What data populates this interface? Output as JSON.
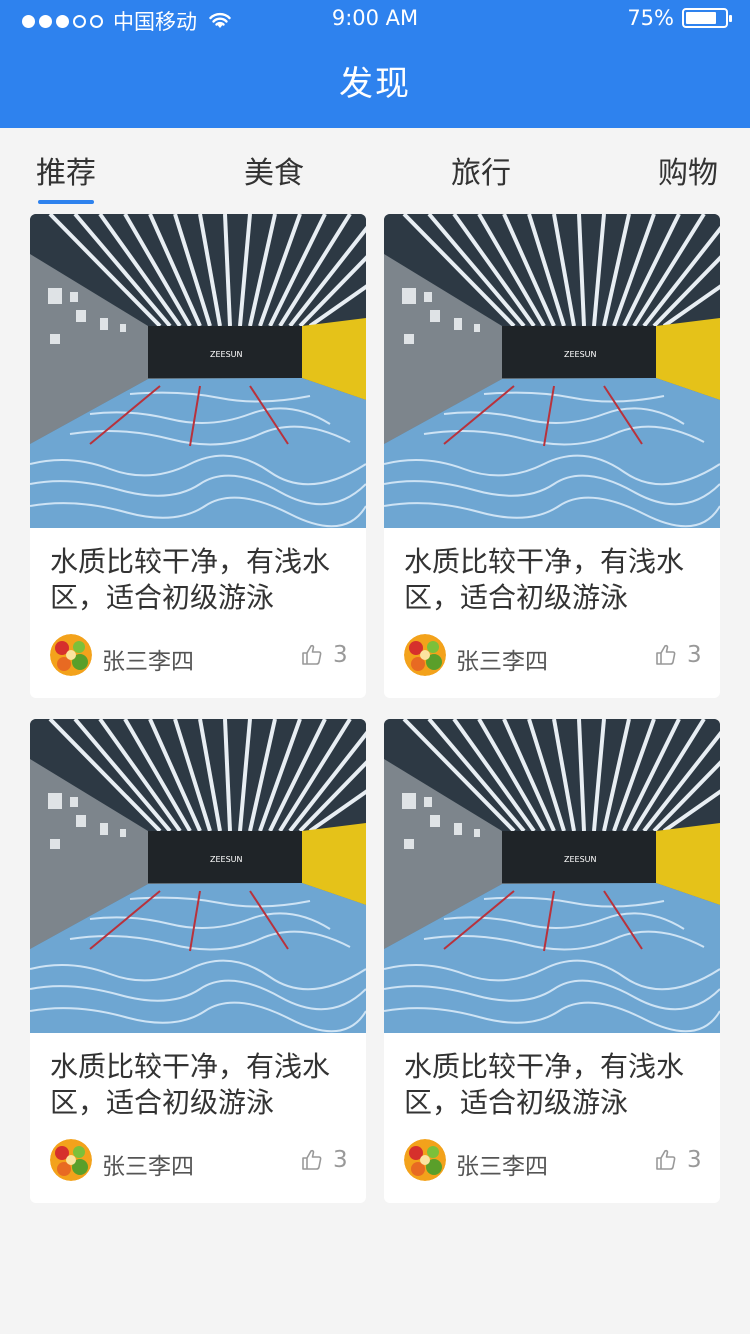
{
  "status_bar": {
    "carrier": "中国移动",
    "time": "9:00 AM",
    "battery_text": "75%",
    "signal_dots": [
      true,
      true,
      true,
      false,
      false
    ]
  },
  "header": {
    "title": "发现",
    "background": "#2e82ee"
  },
  "tabs": [
    {
      "label": "推荐",
      "active": true
    },
    {
      "label": "美食",
      "active": false
    },
    {
      "label": "旅行",
      "active": false
    },
    {
      "label": "购物",
      "active": false
    }
  ],
  "cards": [
    {
      "text": "水质比较干净，有浅水区，适合初级游泳",
      "author": "张三李四",
      "likes": "3",
      "image": "indoor swimming pool photo"
    },
    {
      "text": "水质比较干净，有浅水区，适合初级游泳",
      "author": "张三李四",
      "likes": "3",
      "image": "indoor swimming pool photo"
    },
    {
      "text": "水质比较干净，有浅水区，适合初级游泳",
      "author": "张三李四",
      "likes": "3",
      "image": "indoor swimming pool photo"
    },
    {
      "text": "水质比较干净，有浅水区，适合初级游泳",
      "author": "张三李四",
      "likes": "3",
      "image": "indoor swimming pool photo"
    }
  ],
  "icons": {
    "like": "thumbs-up-icon",
    "wifi": "wifi-icon",
    "battery": "battery-icon"
  }
}
